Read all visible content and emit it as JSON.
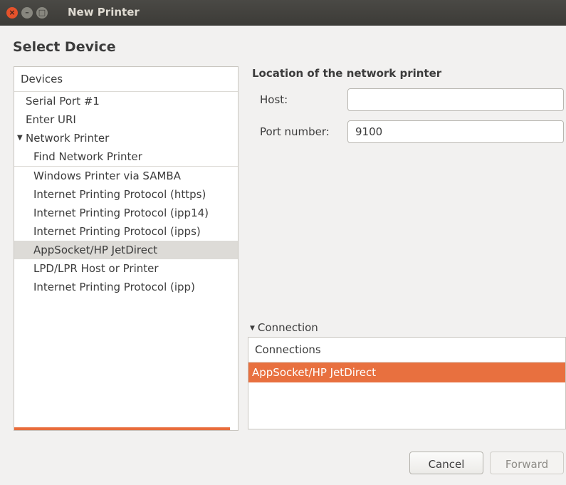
{
  "window": {
    "title": "New Printer",
    "close_glyph": "×",
    "min_glyph": "–",
    "max_glyph": "□"
  },
  "page": {
    "heading": "Select Device"
  },
  "devices": {
    "header": "Devices",
    "items": [
      {
        "label": "Serial Port #1"
      },
      {
        "label": "Enter URI"
      },
      {
        "label": "Network Printer",
        "expanded": true
      },
      {
        "label": "Find Network Printer"
      },
      {
        "label": "Windows Printer via SAMBA"
      },
      {
        "label": "Internet Printing Protocol (https)"
      },
      {
        "label": "Internet Printing Protocol (ipp14)"
      },
      {
        "label": "Internet Printing Protocol (ipps)"
      },
      {
        "label": "AppSocket/HP JetDirect",
        "selected": true
      },
      {
        "label": "LPD/LPR Host or Printer"
      },
      {
        "label": "Internet Printing Protocol (ipp)"
      }
    ]
  },
  "location": {
    "title": "Location of the network printer",
    "host_label": "Host:",
    "host_value": "",
    "port_label": "Port number:",
    "port_value": "9100"
  },
  "connection": {
    "expander_label": "Connection",
    "header": "Connections",
    "items": [
      "AppSocket/HP JetDirect"
    ]
  },
  "buttons": {
    "cancel": "Cancel",
    "forward": "Forward"
  },
  "colors": {
    "accent": "#e8703f",
    "titlebar": "#3c3b37",
    "selection": "#dddbd7"
  }
}
